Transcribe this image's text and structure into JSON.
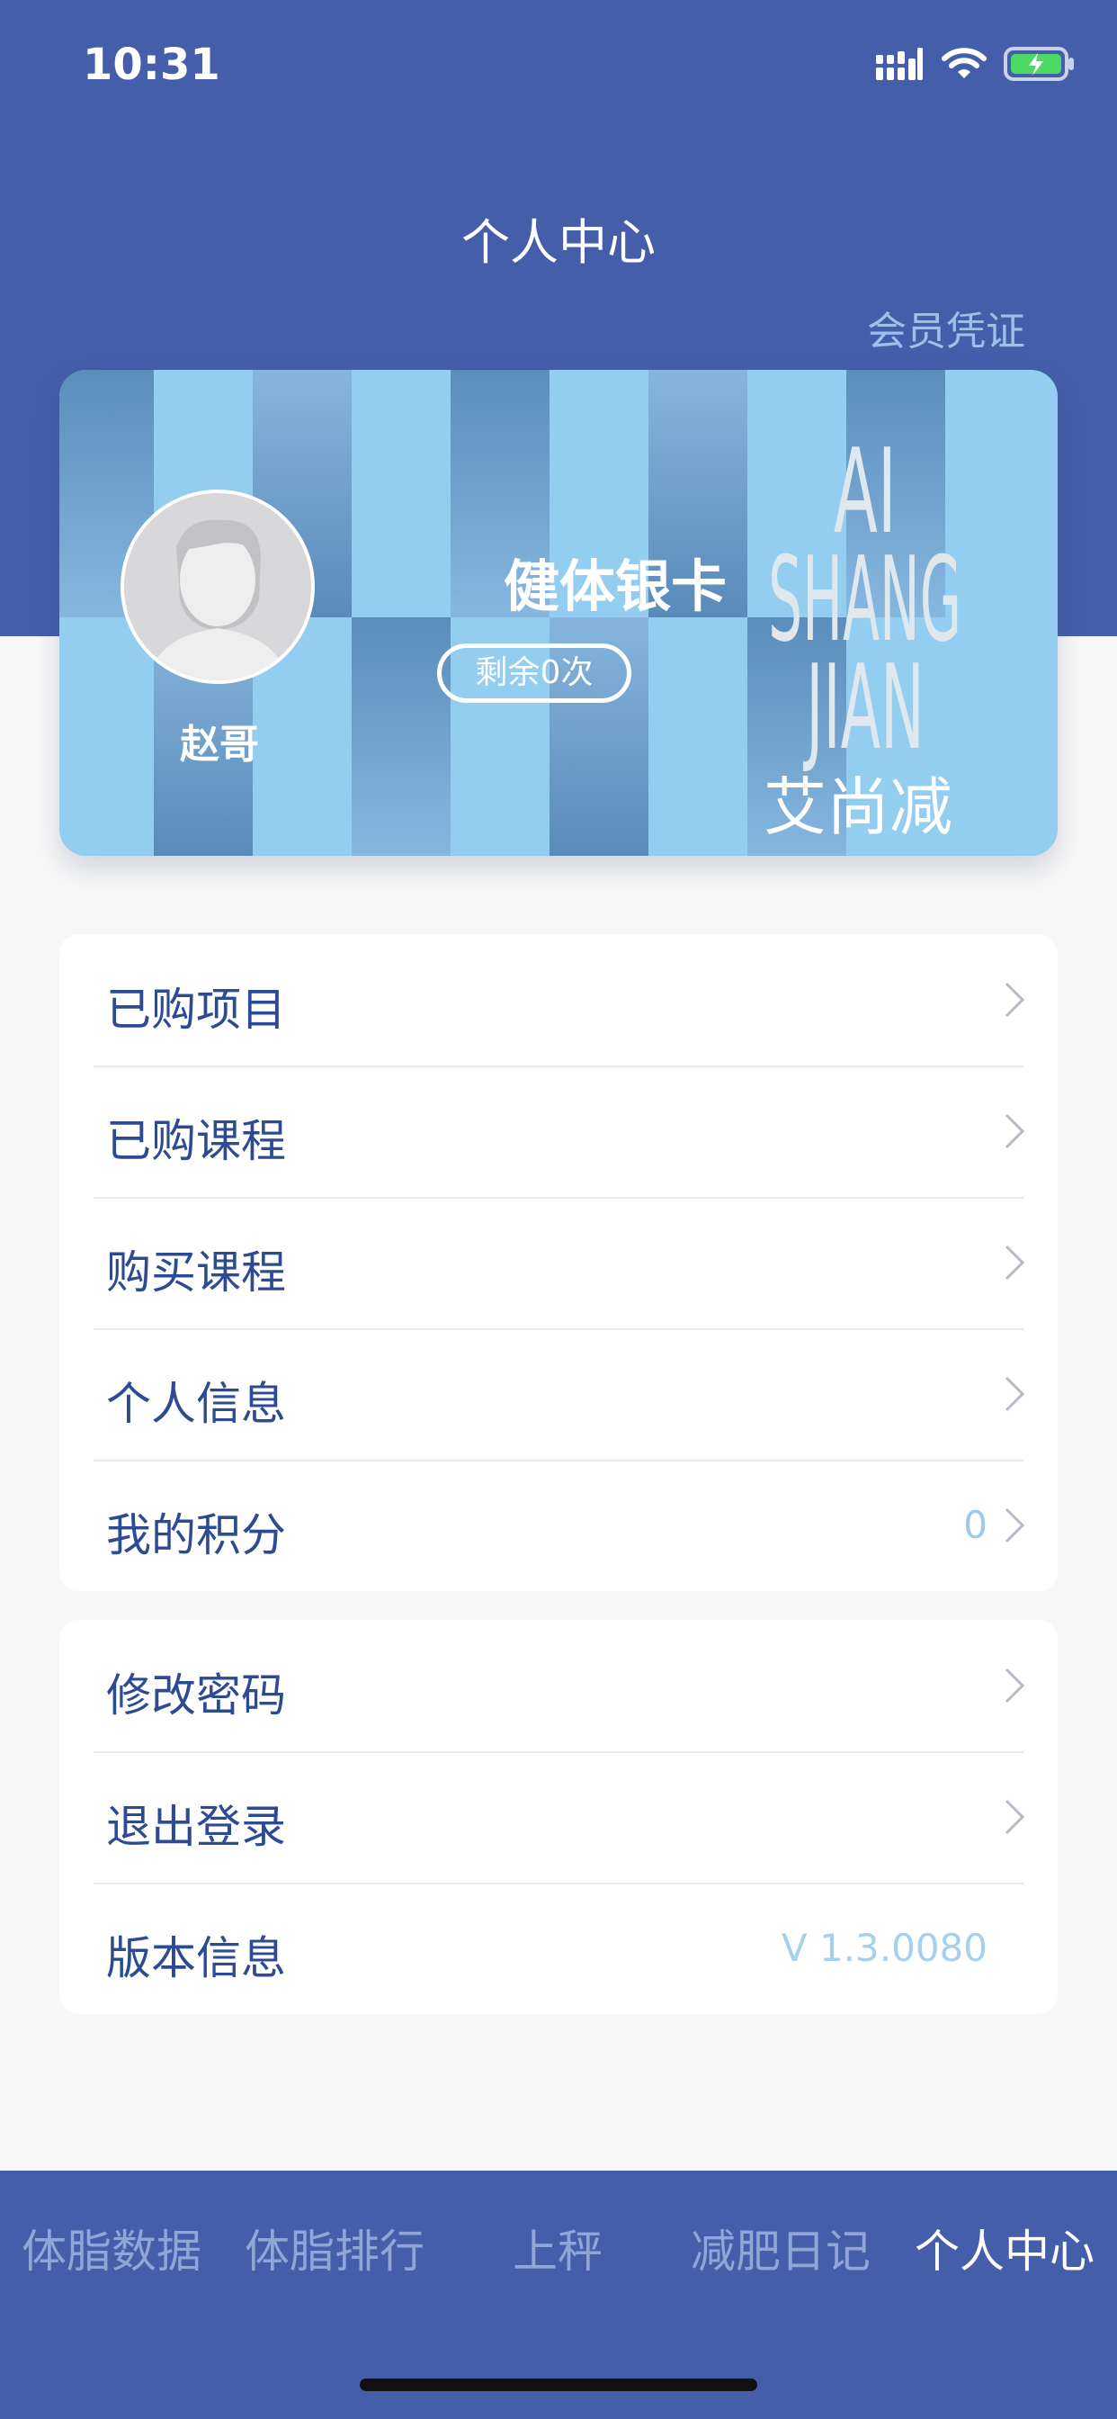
{
  "status_bar": {
    "time": "10:31",
    "icons": [
      "signal-icon",
      "wifi-icon",
      "battery-charging-icon"
    ],
    "battery_color": "#4cd964"
  },
  "header": {
    "title": "个人中心",
    "member_link": "会员凭证",
    "background_color": "#455ea9"
  },
  "card": {
    "user_name": "赵哥",
    "card_name": "健体银卡",
    "remaining": "剩余0次",
    "brand_latin_lines": [
      "AI",
      "SHANG",
      "JIAN"
    ],
    "brand_cn": "艾尚减",
    "avatar_icon": "default-avatar-icon"
  },
  "menu_group_1": [
    {
      "label": "已购项目"
    },
    {
      "label": "已购课程"
    },
    {
      "label": "购买课程"
    },
    {
      "label": "个人信息"
    },
    {
      "label": "我的积分",
      "value": "0"
    }
  ],
  "menu_group_2": [
    {
      "label": "修改密码"
    },
    {
      "label": "退出登录"
    },
    {
      "label": "版本信息",
      "value": "V 1.3.0080"
    }
  ],
  "tabs": [
    {
      "label": "体脂数据",
      "active": false
    },
    {
      "label": "体脂排行",
      "active": false
    },
    {
      "label": "上秤",
      "active": false
    },
    {
      "label": "减肥日记",
      "active": false
    },
    {
      "label": "个人中心",
      "active": true
    }
  ],
  "colors": {
    "accent": "#455ea9",
    "menu_text": "#2d4b93",
    "muted_value": "#9dc8ea",
    "card_light": "#93cdef",
    "card_dark": "#5d8fbe"
  }
}
